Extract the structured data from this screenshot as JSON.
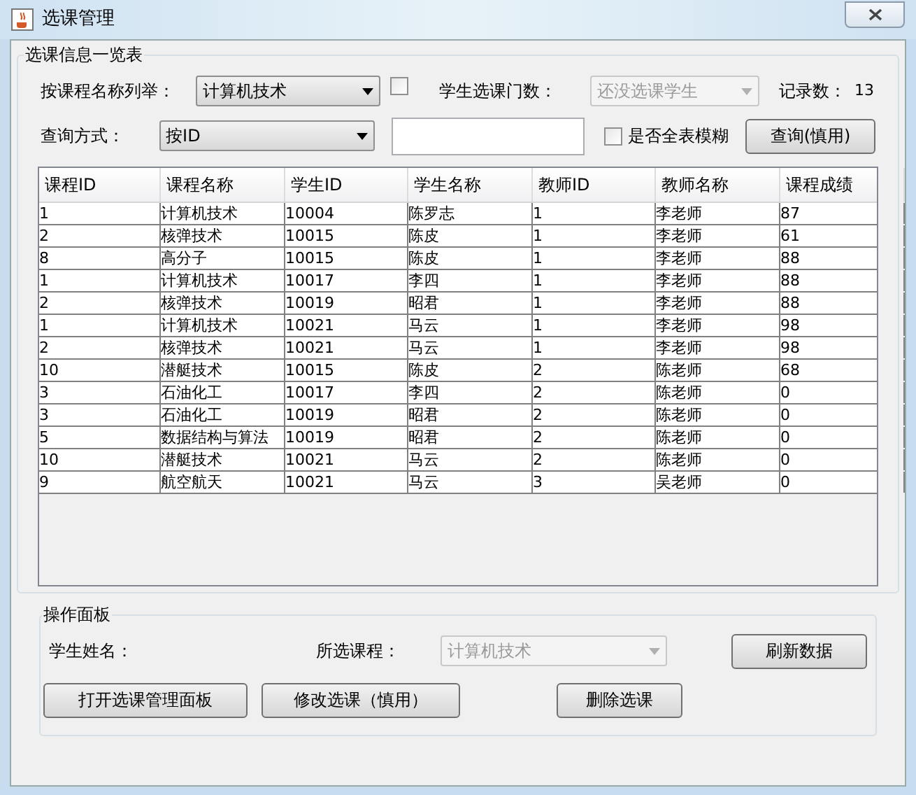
{
  "window": {
    "title": "选课管理"
  },
  "list_panel": {
    "title": "选课信息一览表",
    "course_filter": {
      "label": "按课程名称列举：",
      "value": "计算机技术",
      "checked": false
    },
    "course_count": {
      "label": "学生选课门数：",
      "value": "还没选课学生",
      "disabled": true
    },
    "record_count": {
      "label": "记录数：",
      "value": "13"
    },
    "query_mode": {
      "label": "查询方式：",
      "value": "按ID"
    },
    "fuzzy": {
      "label": "是否全表模糊",
      "checked": false
    },
    "query_button": "查询(慎用)"
  },
  "table": {
    "columns": [
      "课程ID",
      "课程名称",
      "学生ID",
      "学生名称",
      "教师ID",
      "教师名称",
      "课程成绩"
    ],
    "rows": [
      [
        "1",
        "计算机技术",
        "10004",
        "陈罗志",
        "1",
        "李老师",
        "87"
      ],
      [
        "2",
        "核弹技术",
        "10015",
        "陈皮",
        "1",
        "李老师",
        "61"
      ],
      [
        "8",
        "高分子",
        "10015",
        "陈皮",
        "1",
        "李老师",
        "88"
      ],
      [
        "1",
        "计算机技术",
        "10017",
        "李四",
        "1",
        "李老师",
        "88"
      ],
      [
        "2",
        "核弹技术",
        "10019",
        "昭君",
        "1",
        "李老师",
        "88"
      ],
      [
        "1",
        "计算机技术",
        "10021",
        "马云",
        "1",
        "李老师",
        "98"
      ],
      [
        "2",
        "核弹技术",
        "10021",
        "马云",
        "1",
        "李老师",
        "98"
      ],
      [
        "10",
        "潜艇技术",
        "10015",
        "陈皮",
        "2",
        "陈老师",
        "68"
      ],
      [
        "3",
        "石油化工",
        "10017",
        "李四",
        "2",
        "陈老师",
        "0"
      ],
      [
        "3",
        "石油化工",
        "10019",
        "昭君",
        "2",
        "陈老师",
        "0"
      ],
      [
        "5",
        "数据结构与算法",
        "10019",
        "昭君",
        "2",
        "陈老师",
        "0"
      ],
      [
        "10",
        "潜艇技术",
        "10021",
        "马云",
        "2",
        "陈老师",
        "0"
      ],
      [
        "9",
        "航空航天",
        "10021",
        "马云",
        "3",
        "吴老师",
        "0"
      ]
    ]
  },
  "operation_panel": {
    "title": "操作面板",
    "student_name": {
      "label": "学生姓名："
    },
    "selected_course": {
      "label": "所选课程：",
      "value": "计算机技术",
      "disabled": true
    },
    "buttons": [
      "刷新数据",
      "打开选课管理面板",
      "修改选课（慎用）",
      "删除选课"
    ]
  }
}
